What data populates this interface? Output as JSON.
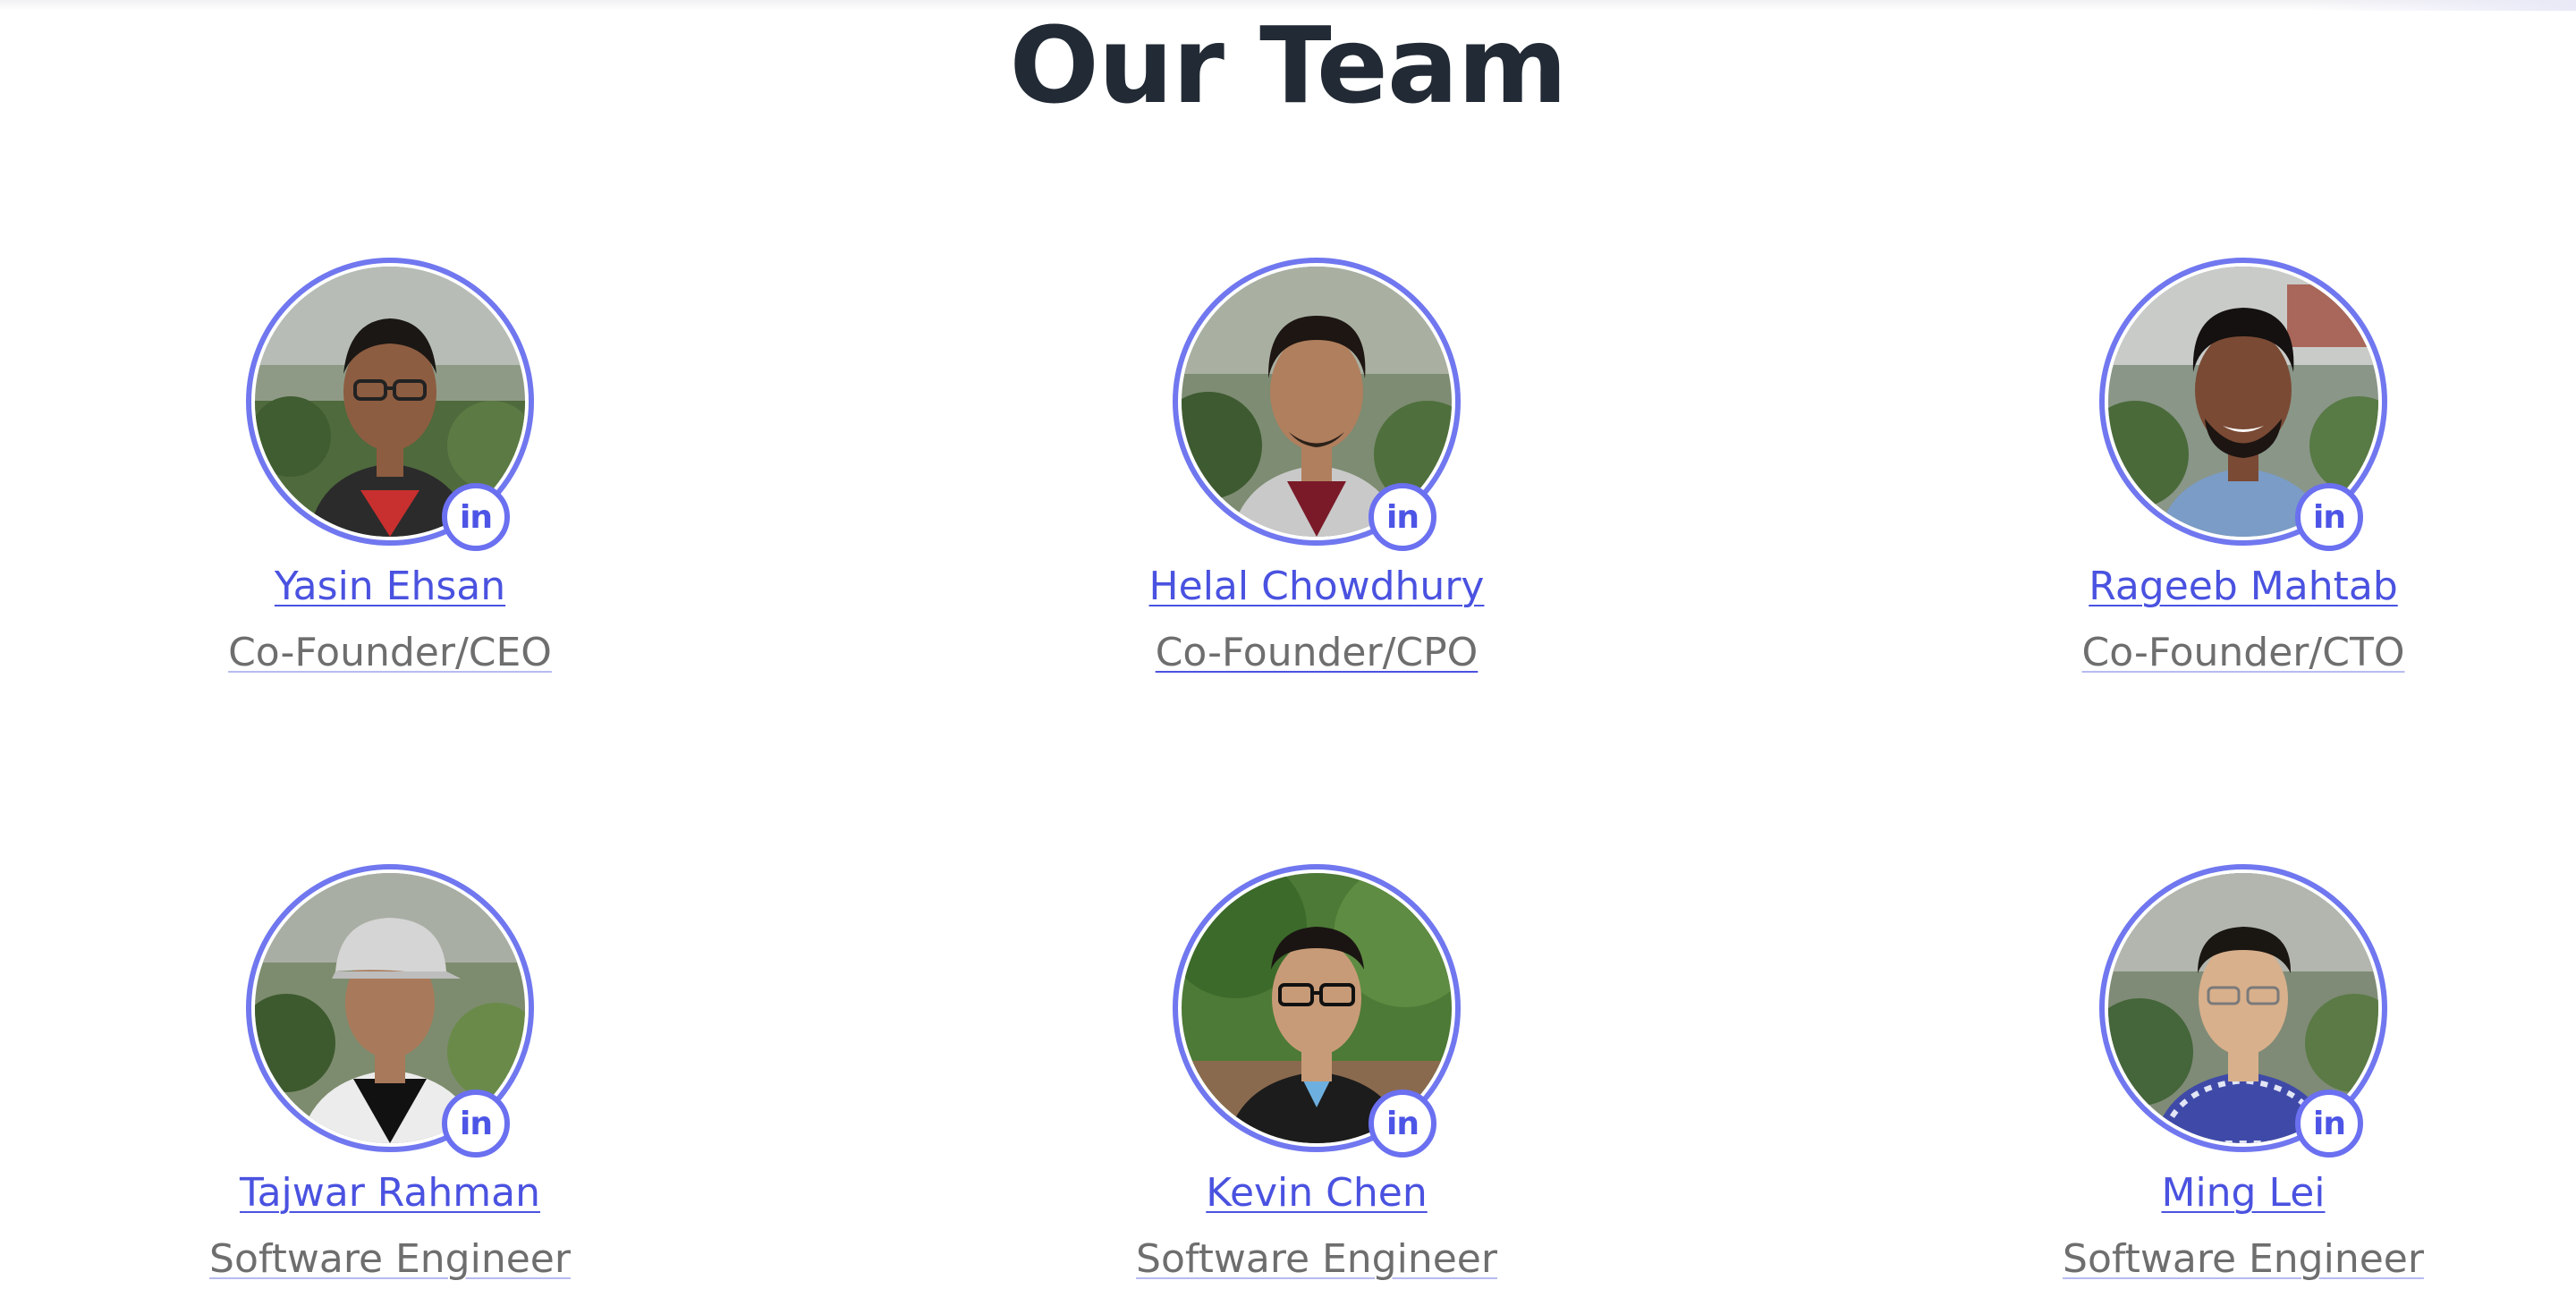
{
  "page": {
    "title": "Our Team"
  },
  "colors": {
    "title": "#222a35",
    "accent": "#4a52e0",
    "ring": "#7077ef",
    "role_text": "#6e6e6e"
  },
  "team": [
    {
      "name": "Yasin Ehsan",
      "role": "Co-Founder/CEO",
      "social_icon": "linkedin-icon",
      "social_label": "in"
    },
    {
      "name": "Helal Chowdhury",
      "role": "Co-Founder/CPO",
      "social_icon": "linkedin-icon",
      "social_label": "in"
    },
    {
      "name": "Rageeb Mahtab",
      "role": "Co-Founder/CTO",
      "social_icon": "linkedin-icon",
      "social_label": "in"
    },
    {
      "name": "Tajwar Rahman",
      "role": "Software Engineer",
      "social_icon": "linkedin-icon",
      "social_label": "in"
    },
    {
      "name": "Kevin Chen",
      "role": "Software Engineer",
      "social_icon": "linkedin-icon",
      "social_label": "in"
    },
    {
      "name": "Ming Lei",
      "role": "Software Engineer",
      "social_icon": "linkedin-icon",
      "social_label": "in"
    }
  ]
}
